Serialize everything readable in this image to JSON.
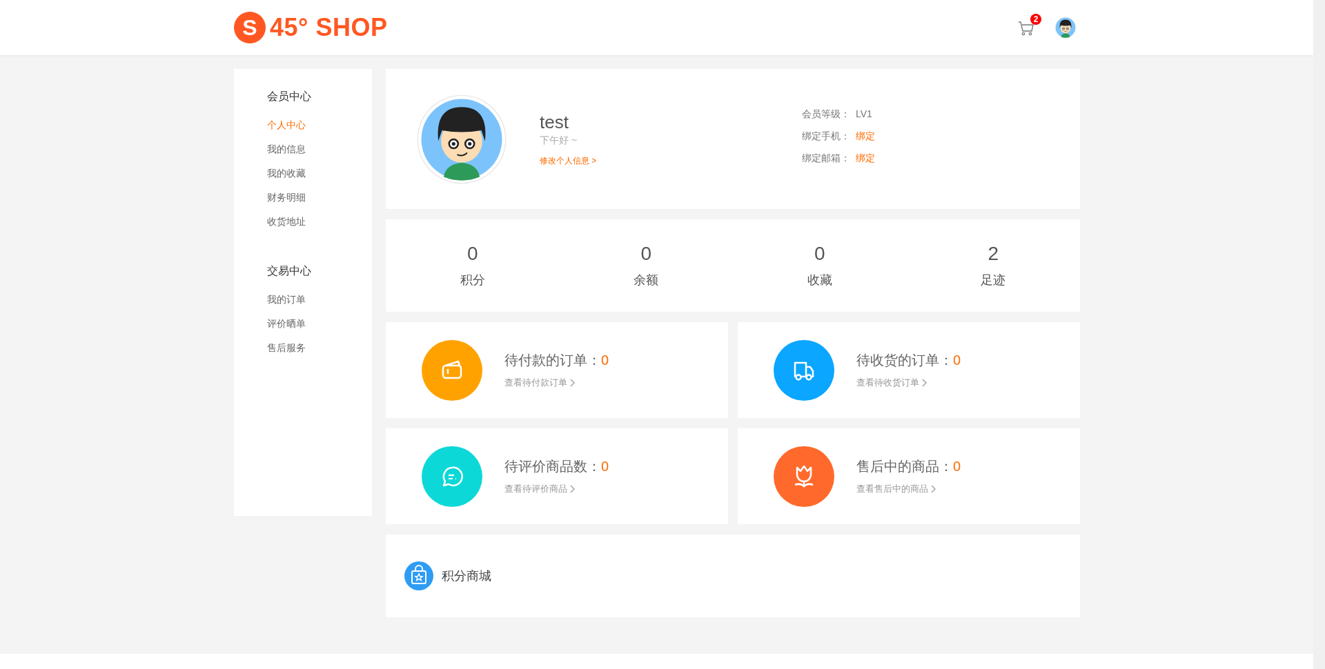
{
  "header": {
    "logo": {
      "mark": "S",
      "text": "45° SHOP"
    },
    "cart_badge": "2"
  },
  "sidebar": {
    "sections": [
      {
        "title": "会员中心",
        "items": [
          {
            "label": "个人中心",
            "selected": true
          },
          {
            "label": "我的信息",
            "selected": false
          },
          {
            "label": "我的收藏",
            "selected": false
          },
          {
            "label": "财务明细",
            "selected": false
          },
          {
            "label": "收货地址",
            "selected": false
          }
        ]
      },
      {
        "title": "交易中心",
        "items": [
          {
            "label": "我的订单",
            "selected": false
          },
          {
            "label": "评价晒单",
            "selected": false
          },
          {
            "label": "售后服务",
            "selected": false
          }
        ]
      }
    ]
  },
  "profile": {
    "name": "test",
    "greeting": "下午好 ~",
    "edit_link": "修改个人信息 >",
    "details": [
      {
        "label": "会员等级：",
        "value": "LV1",
        "kind": "text"
      },
      {
        "label": "绑定手机：",
        "value": "绑定",
        "kind": "link"
      },
      {
        "label": "绑定邮箱：",
        "value": "绑定",
        "kind": "link"
      }
    ]
  },
  "stats": [
    {
      "value": "0",
      "label": "积分"
    },
    {
      "value": "0",
      "label": "余额"
    },
    {
      "value": "0",
      "label": "收藏"
    },
    {
      "value": "2",
      "label": "足迹"
    }
  ],
  "order_cards": [
    {
      "kind": "wallet",
      "color": "#ffa200",
      "title": "待付款的订单：",
      "count": "0",
      "link": "查看待付款订单"
    },
    {
      "kind": "truck",
      "color": "#0aa6ff",
      "title": "待收货的订单：",
      "count": "0",
      "link": "查看待收货订单"
    },
    {
      "kind": "chat",
      "color": "#0cd8d8",
      "title": "待评价商品数：",
      "count": "0",
      "link": "查看待评价商品"
    },
    {
      "kind": "tulip",
      "color": "#ff6a2c",
      "title": "售后中的商品：",
      "count": "0",
      "link": "查看售后中的商品"
    }
  ],
  "points_mall": {
    "title": "积分商城"
  }
}
